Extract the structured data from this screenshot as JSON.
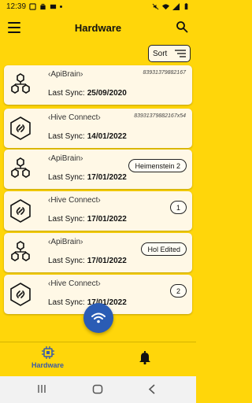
{
  "status_bar": {
    "time": "12:39"
  },
  "app_bar": {
    "title": "Hardware"
  },
  "sort": {
    "label": "Sort"
  },
  "devices": [
    {
      "type": "ApiBrain",
      "name": "‹ApiBrain›",
      "id": "83931379882167",
      "sync_label": "Last Sync:",
      "sync_date": "25/09/2020",
      "badge": ""
    },
    {
      "type": "HiveConnect",
      "name": "‹Hive Connect›",
      "id": "83931379882167x54",
      "sync_label": "Last Sync:",
      "sync_date": "14/01/2022",
      "badge": ""
    },
    {
      "type": "ApiBrain",
      "name": "‹ApiBrain›",
      "id": "",
      "sync_label": "Last Sync:",
      "sync_date": "17/01/2022",
      "badge": "Heimenstein 2"
    },
    {
      "type": "HiveConnect",
      "name": "‹Hive Connect›",
      "id": "",
      "sync_label": "Last Sync:",
      "sync_date": "17/01/2022",
      "badge": "1"
    },
    {
      "type": "ApiBrain",
      "name": "‹ApiBrain›",
      "id": "",
      "sync_label": "Last Sync:",
      "sync_date": "17/01/2022",
      "badge": "Hol Edited"
    },
    {
      "type": "HiveConnect",
      "name": "‹Hive Connect›",
      "id": "",
      "sync_label": "Last Sync:",
      "sync_date": "17/01/2022",
      "badge": "2"
    }
  ],
  "bottom_nav": [
    {
      "label": "Hardware",
      "icon": "chip-icon",
      "active": true
    },
    {
      "label": "",
      "icon": "bell-icon",
      "active": false
    }
  ],
  "colors": {
    "background": "#FFD60A",
    "card": "#FFF8E6",
    "accent": "#2A5CB5",
    "nav_active": "#3B5BA8"
  }
}
